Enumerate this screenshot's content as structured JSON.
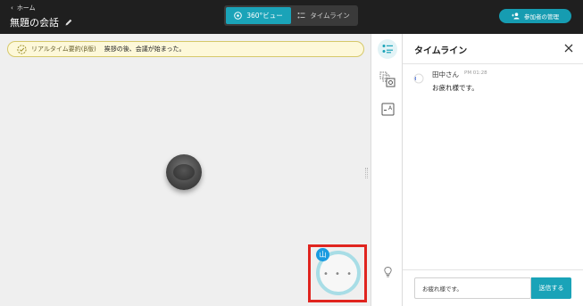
{
  "header": {
    "back_label": "ホーム",
    "title": "無題の会話",
    "view_tabs": [
      {
        "label": "360°ビュー",
        "active": true
      },
      {
        "label": "タイムライン",
        "active": false
      }
    ],
    "manage_label": "参加者の管理"
  },
  "summary": {
    "label": "リアルタイム要約(β版)",
    "text": "挨拶の後、会議が始まった。"
  },
  "participant": {
    "initial": "山",
    "status": "• • •"
  },
  "timeline": {
    "title": "タイムライン",
    "messages": [
      {
        "name": "田中さん",
        "time": "PM 01:28",
        "text": "お疲れ様です。"
      }
    ],
    "input_value": "お疲れ様です。",
    "send_label": "送信する"
  },
  "colors": {
    "accent": "#1aa3b8",
    "header_bg": "#1f1f1f",
    "highlight": "#e0241f"
  }
}
